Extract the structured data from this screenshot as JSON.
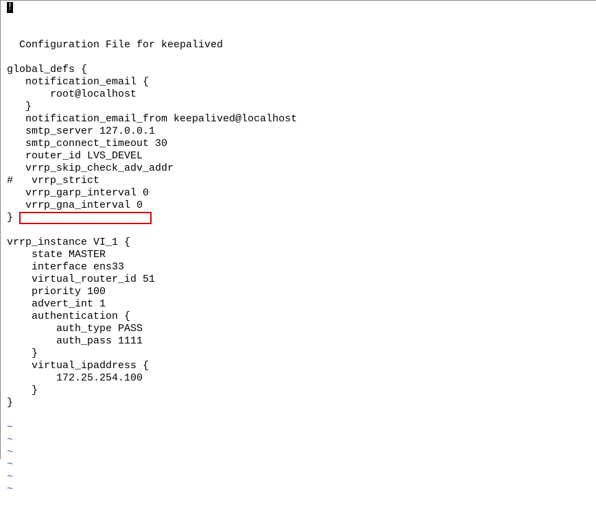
{
  "editor": {
    "cursor_char": "!",
    "lines": [
      " Configuration File for keepalived",
      "",
      "global_defs {",
      "   notification_email {",
      "       root@localhost",
      "   }",
      "   notification_email_from keepalived@localhost",
      "   smtp_server 127.0.0.1",
      "   smtp_connect_timeout 30",
      "   router_id LVS_DEVEL",
      "   vrrp_skip_check_adv_addr",
      "#   vrrp_strict",
      "   vrrp_garp_interval 0",
      "   vrrp_gna_interval 0",
      "}",
      "",
      "vrrp_instance VI_1 {",
      "    state MASTER",
      "    interface ens33",
      "    virtual_router_id 51",
      "    priority 100",
      "    advert_int 1",
      "    authentication {",
      "        auth_type PASS",
      "        auth_pass 1111",
      "    }",
      "    virtual_ipaddress {",
      "        172.25.254.100",
      "    }",
      "}",
      ""
    ],
    "tilde_lines": 6,
    "tilde_char": "~",
    "highlighted_line_index": 17
  }
}
